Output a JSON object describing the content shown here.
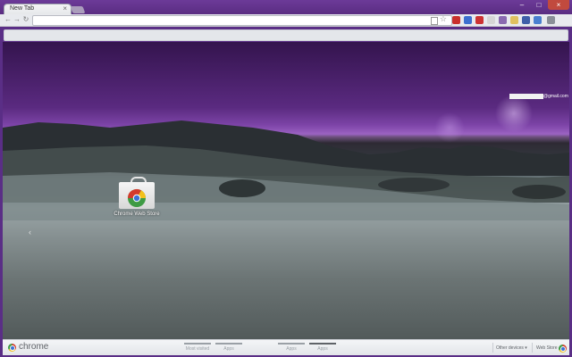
{
  "tab": {
    "title": "New Tab",
    "close": "×"
  },
  "window": {
    "minimize": "–",
    "maximize": "□",
    "close": "×"
  },
  "toolbar": {
    "back": "←",
    "forward": "→",
    "reload": "↻",
    "address_value": "",
    "star": "☆"
  },
  "account": {
    "email_suffix": "@gmail.com"
  },
  "apps": [
    {
      "label": "Chrome Web Store",
      "icon": "chrome-web-store-icon"
    }
  ],
  "pager": {
    "left_arrow": "‹"
  },
  "footer": {
    "brand": "chrome",
    "sections": [
      "Most visited",
      "Apps",
      "Apps",
      "Apps"
    ],
    "active_section": 3,
    "other_devices": "Other devices",
    "other_devices_chevron": "▾",
    "web_store": "Web Store"
  },
  "colors": {
    "sky_top": "#34144e",
    "sky_glow": "#9b63c2",
    "accent": "#5a2e86"
  }
}
